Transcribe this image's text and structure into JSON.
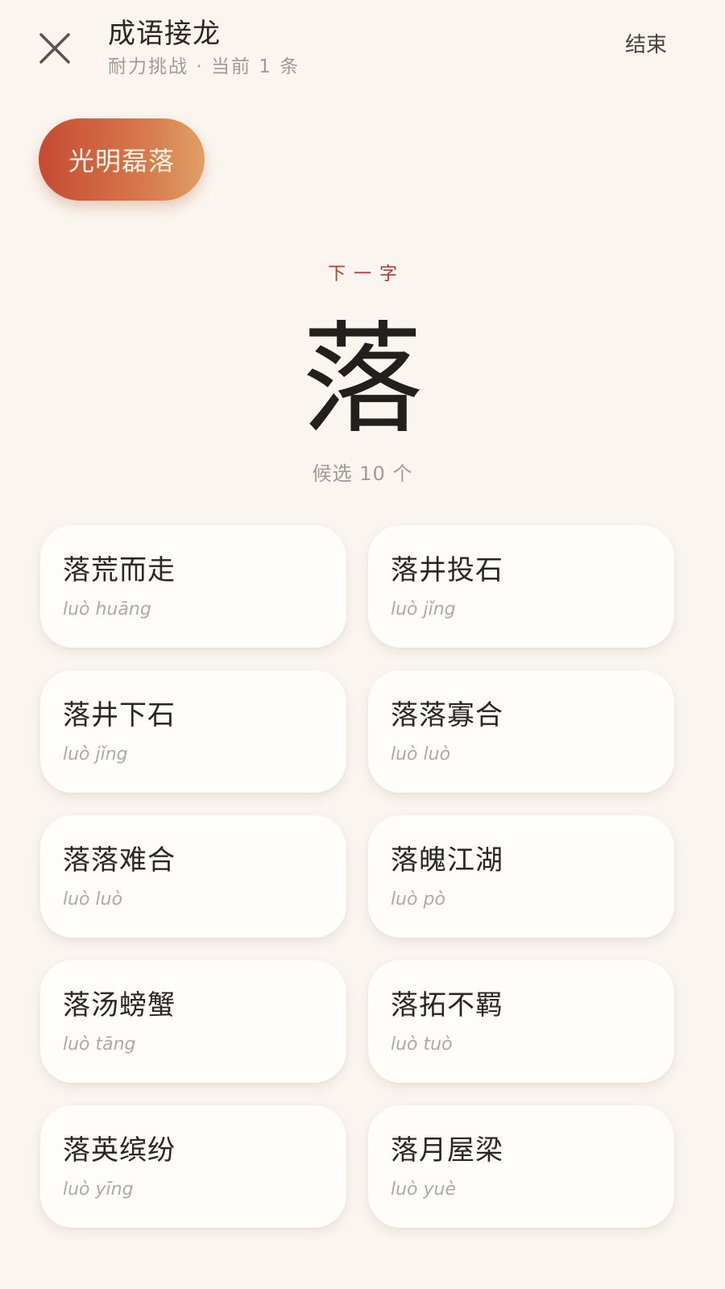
{
  "header": {
    "title": "成语接龙",
    "mode": "耐力挑战",
    "separator": "·",
    "current_text": "当前 1 条",
    "end_label": "结束",
    "close_icon": "close-icon"
  },
  "chain": {
    "current_idiom": "光明磊落"
  },
  "next": {
    "label": "下一字",
    "character": "落",
    "candidate_text": "候选 10 个"
  },
  "candidates": [
    {
      "idiom": "落荒而走",
      "pinyin": "luò huāng"
    },
    {
      "idiom": "落井投石",
      "pinyin": "luò jǐng"
    },
    {
      "idiom": "落井下石",
      "pinyin": "luò jǐng"
    },
    {
      "idiom": "落落寡合",
      "pinyin": "luò luò"
    },
    {
      "idiom": "落落难合",
      "pinyin": "luò luò"
    },
    {
      "idiom": "落魄江湖",
      "pinyin": "luò pò"
    },
    {
      "idiom": "落汤螃蟹",
      "pinyin": "luò tāng"
    },
    {
      "idiom": "落拓不羁",
      "pinyin": "luò tuò"
    },
    {
      "idiom": "落英缤纷",
      "pinyin": "luò yīng"
    },
    {
      "idiom": "落月屋梁",
      "pinyin": "luò yuè"
    }
  ],
  "colors": {
    "background": "#faf5ef",
    "accent": "#b2392b",
    "pill_start": "#c54a33",
    "pill_end": "#e0a064",
    "card": "#fffdfa"
  }
}
